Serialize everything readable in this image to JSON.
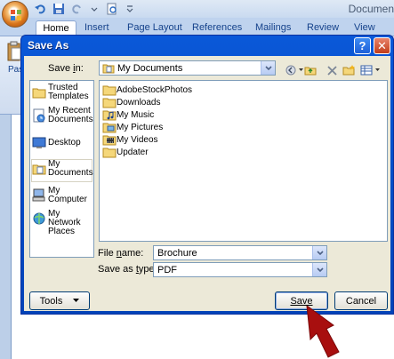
{
  "word": {
    "title_fragment": "Documen",
    "tabs": [
      "Home",
      "Insert",
      "Page Layout",
      "References",
      "Mailings",
      "Review",
      "View"
    ],
    "paste_label": "Pas"
  },
  "dialog": {
    "title": "Save As",
    "help_glyph": "?",
    "close_glyph": "✕",
    "save_in_label": "Save in:",
    "save_in_value": "My Documents",
    "places": [
      {
        "label_line1": "Trusted",
        "label_line2": "Templates",
        "icon": "folder-icon"
      },
      {
        "label_line1": "My Recent",
        "label_line2": "Documents",
        "icon": "recent-documents-icon"
      },
      {
        "label_line1": "Desktop",
        "label_line2": "",
        "icon": "desktop-icon"
      },
      {
        "label_line1": "My",
        "label_line2": "Documents",
        "icon": "my-documents-icon"
      },
      {
        "label_line1": "My",
        "label_line2": "Computer",
        "icon": "computer-icon"
      },
      {
        "label_line1": "My Network",
        "label_line2": "Places",
        "icon": "network-icon"
      }
    ],
    "files": [
      {
        "name": "AdobeStockPhotos",
        "icon": "folder-icon"
      },
      {
        "name": "Downloads",
        "icon": "folder-icon"
      },
      {
        "name": "My Music",
        "icon": "music-folder-icon"
      },
      {
        "name": "My Pictures",
        "icon": "pictures-folder-icon"
      },
      {
        "name": "My Videos",
        "icon": "videos-folder-icon"
      },
      {
        "name": "Updater",
        "icon": "folder-icon"
      }
    ],
    "file_name_label": "File name:",
    "file_name_value": "Brochure",
    "save_as_type_label": "Save as type:",
    "save_as_type_value": "PDF",
    "tools_label": "Tools",
    "save_label": "Save",
    "cancel_label": "Cancel"
  },
  "colors": {
    "dialog_title_bar": "#0a58d8",
    "dialog_client": "#ece9d8",
    "ribbon_tabs": "#bfd3ee",
    "arrow": "#a80f0f"
  }
}
